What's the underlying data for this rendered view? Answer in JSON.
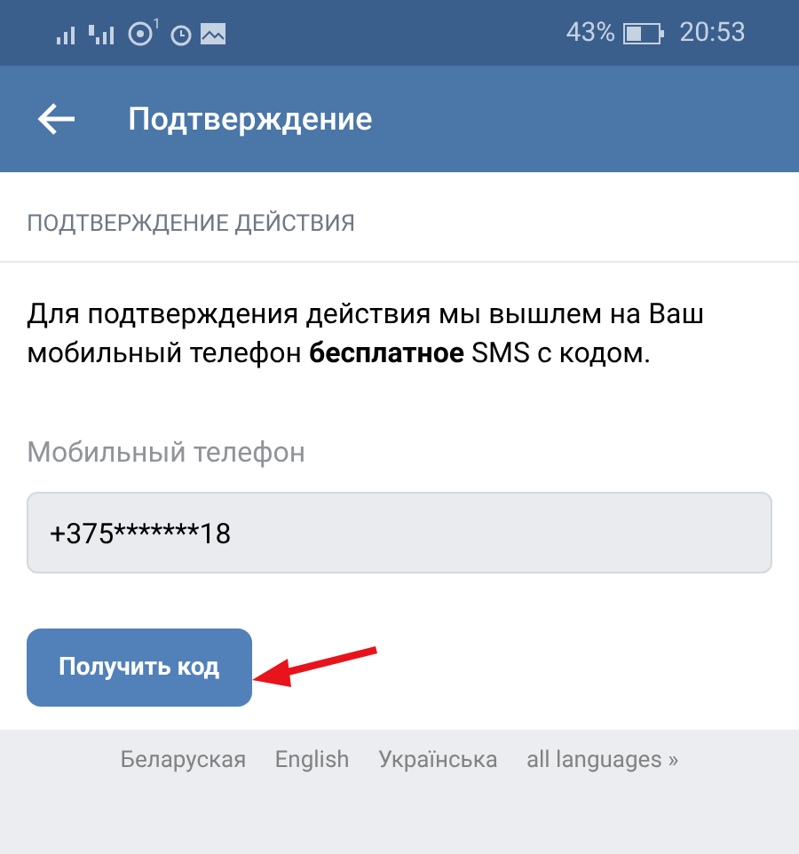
{
  "status_bar": {
    "notification_count": "1",
    "battery": "43%",
    "time": "20:53"
  },
  "header": {
    "title": "Подтверждение"
  },
  "section": {
    "title": "ПОДТВЕРЖДЕНИЕ ДЕЙСТВИЯ",
    "text": "Для подтверждения действия мы вышлем на Ваш мобильный телефон **бесплатное** SMS с кодом."
  },
  "phone_field": {
    "label": "Мобильный телефон",
    "value": "+375*******18"
  },
  "button": {
    "label": "Получить код"
  },
  "languages": [
    "Беларуская",
    "English",
    "Українська",
    "all languages »"
  ]
}
